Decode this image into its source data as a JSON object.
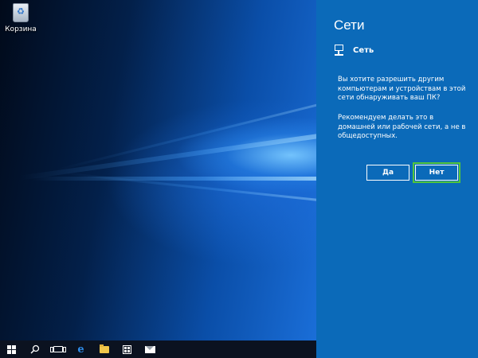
{
  "desktop": {
    "icons": [
      {
        "label": "Корзина",
        "icon": "recycle-bin-icon"
      }
    ]
  },
  "panel": {
    "title": "Сети",
    "network": {
      "icon": "network-monitor-icon",
      "name": "Сеть"
    },
    "question": "Вы хотите разрешить другим компьютерам и устройствам в этой сети обнаруживать ваш ПК?",
    "recommendation": "Рекомендуем делать это в домашней или рабочей сети, а не в общедоступных.",
    "buttons": {
      "yes": "Да",
      "no": "Нет"
    }
  },
  "taskbar": {
    "items": [
      "start-icon",
      "search-icon",
      "task-view-icon",
      "edge-icon",
      "file-explorer-icon",
      "store-icon",
      "mail-icon"
    ]
  },
  "colors": {
    "panel_bg": "#0b6ab9",
    "taskbar_bg": "#0b1220",
    "focus_outline": "#53c63a",
    "edge_blue": "#2f8dea"
  }
}
